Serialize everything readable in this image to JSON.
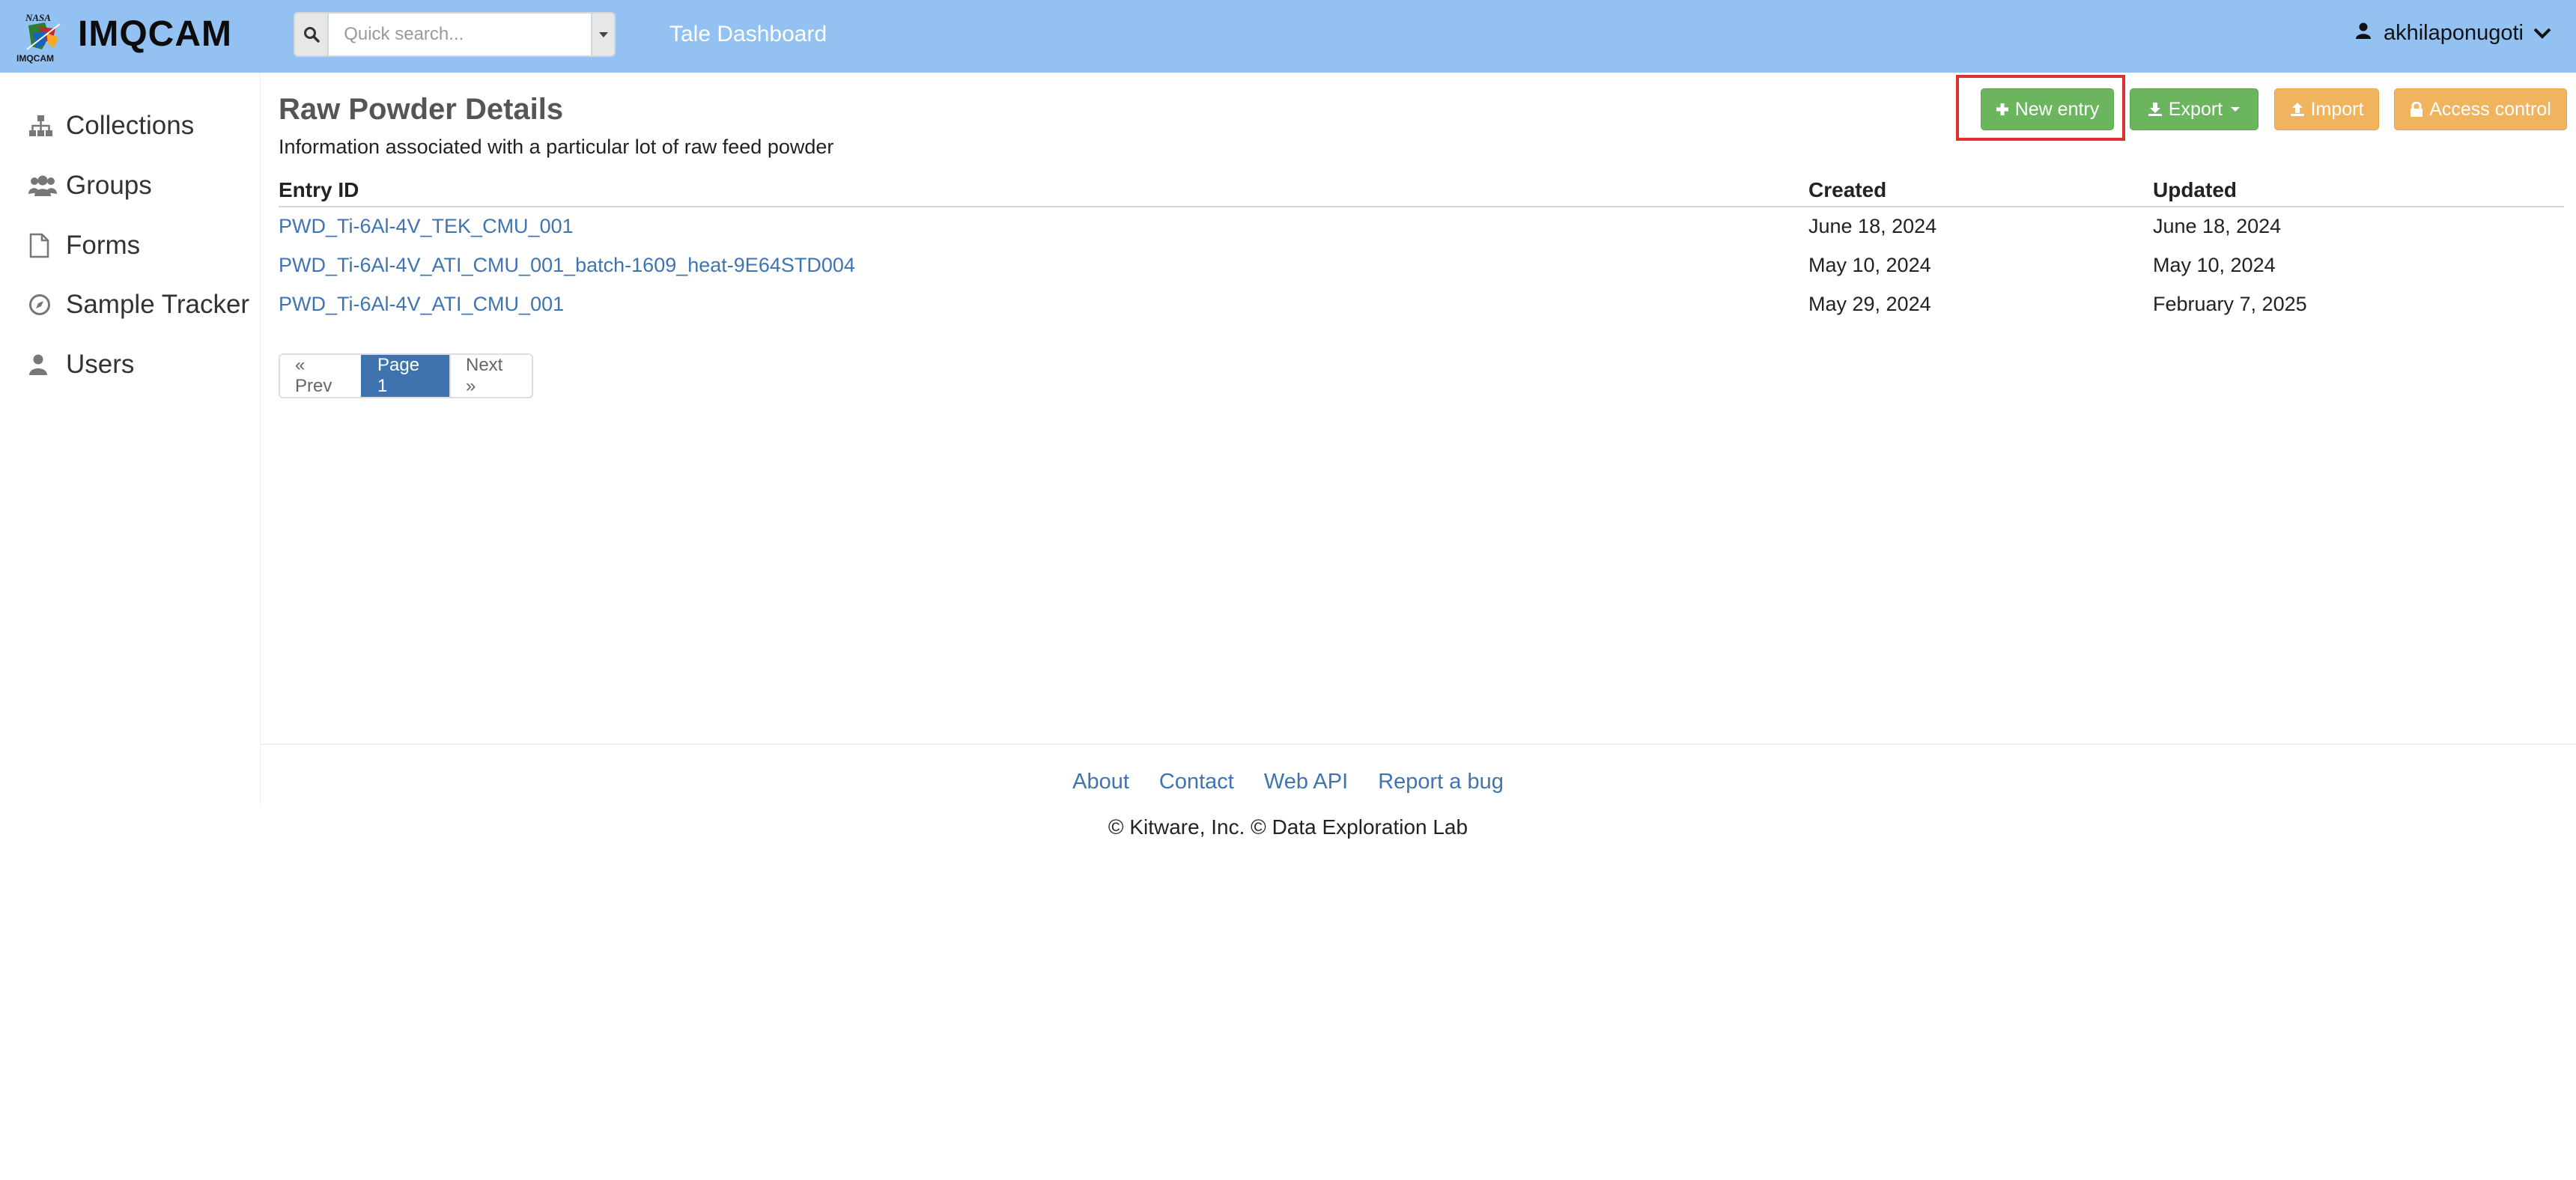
{
  "header": {
    "logo_small_top": "NASA",
    "logo_small_bottom": "IMQCAM",
    "brand": "IMQCAM",
    "search_placeholder": "Quick search...",
    "tale_link": "Tale Dashboard",
    "username": "akhilaponugoti",
    "bg_color": "#93c1f2"
  },
  "sidebar": {
    "items": [
      {
        "label": "Collections",
        "icon": "sitemap-icon"
      },
      {
        "label": "Groups",
        "icon": "users-icon"
      },
      {
        "label": "Forms",
        "icon": "file-icon"
      },
      {
        "label": "Sample Tracker",
        "icon": "compass-icon"
      },
      {
        "label": "Users",
        "icon": "user-icon"
      }
    ]
  },
  "main": {
    "title": "Raw Powder Details",
    "description": "Information associated with a particular lot of raw feed powder",
    "buttons": {
      "new_entry": "New entry",
      "export": "Export",
      "import": "Import",
      "access_control": "Access control"
    },
    "table": {
      "headers": [
        "Entry ID",
        "Created",
        "Updated"
      ],
      "rows": [
        {
          "id": "PWD_Ti-6Al-4V_TEK_CMU_001",
          "created": "June 18, 2024",
          "updated": "June 18, 2024"
        },
        {
          "id": "PWD_Ti-6Al-4V_ATI_CMU_001_batch-1609_heat-9E64STD004",
          "created": "May 10, 2024",
          "updated": "May 10, 2024"
        },
        {
          "id": "PWD_Ti-6Al-4V_ATI_CMU_001",
          "created": "May 29, 2024",
          "updated": "February 7, 2025"
        }
      ]
    },
    "pagination": {
      "prev": "« Prev",
      "current": "Page 1",
      "next": "Next »"
    }
  },
  "footer": {
    "links": [
      "About",
      "Contact",
      "Web API",
      "Report a bug"
    ],
    "copyright": "© Kitware, Inc. © Data Exploration Lab"
  },
  "colors": {
    "green": "#6ab55e",
    "orange": "#f0b35e",
    "link": "#3e74b2",
    "highlight": "#e0322d"
  }
}
